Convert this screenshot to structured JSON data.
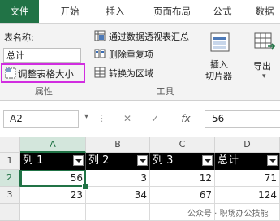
{
  "tabs": [
    "文件",
    "开始",
    "插入",
    "页面布局",
    "公式",
    "数据"
  ],
  "active_tab": "文件",
  "ribbon": {
    "properties": {
      "table_name_label": "表名称:",
      "table_name_value": "总计",
      "resize_label": "调整表格大小",
      "group_label": "属性"
    },
    "tools": {
      "pivot_label": "通过数据透视表汇总",
      "remove_dup_label": "删除重复项",
      "convert_label": "转换为区域",
      "group_label": "工具"
    },
    "slicer_label_line1": "插入",
    "slicer_label_line2": "切片器",
    "export_label": "导出"
  },
  "formula_bar": {
    "cell_ref": "A2",
    "fx_symbol": "fx",
    "value": "56"
  },
  "grid": {
    "columns": [
      "A",
      "B",
      "C",
      "D"
    ],
    "rows": [
      "1",
      "2",
      "3"
    ],
    "headers": [
      "列 1",
      "列 2",
      "列 3",
      "总计"
    ],
    "data": [
      [
        "56",
        "3",
        "12",
        "71"
      ],
      [
        "23",
        "34",
        "67",
        "124"
      ]
    ]
  },
  "watermark": "公众号 · 职场办公技能",
  "colors": {
    "accent": "#217346",
    "highlight": "#d12de0",
    "table_header_bg": "#000000"
  }
}
